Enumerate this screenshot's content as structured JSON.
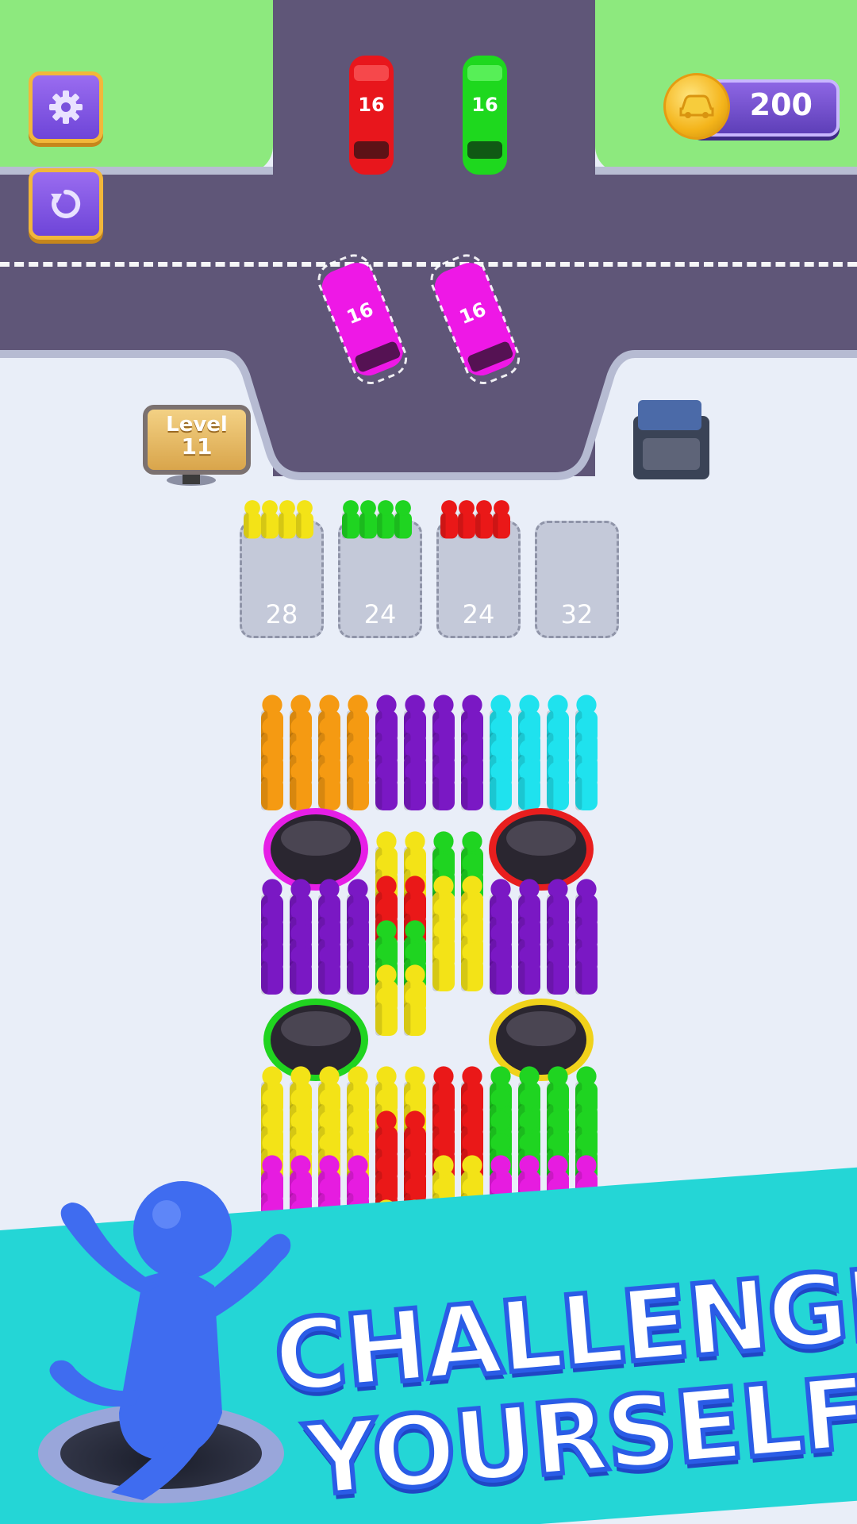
{
  "hud": {
    "coins": "200",
    "settings_icon": "gear-icon",
    "restart_icon": "restart-icon",
    "coin_icon": "coin-car-icon"
  },
  "buses_parked": [
    {
      "color": "#e8161c",
      "capacity": "16"
    },
    {
      "color": "#1ed81e",
      "capacity": "16"
    },
    {
      "color": "#ee18e6",
      "capacity": "16"
    },
    {
      "color": "#ee18e6",
      "capacity": "16"
    }
  ],
  "level": {
    "label": "Level",
    "number": "11"
  },
  "slots": [
    {
      "count": "28",
      "color": "#f3e317"
    },
    {
      "count": "24",
      "color": "#1fd421"
    },
    {
      "count": "24",
      "color": "#ea1818"
    },
    {
      "count": "32",
      "color": null
    }
  ],
  "holes": [
    {
      "color": "#e61ee6"
    },
    {
      "color": "#e81e1e"
    },
    {
      "color": "#20d420"
    },
    {
      "color": "#f0d21a"
    }
  ],
  "colors": {
    "orange": "#f59a12",
    "purple": "#7a18c4",
    "cyan": "#1fe2ee",
    "yellow": "#f3e317",
    "green": "#1fd421",
    "red": "#ea1818",
    "magenta": "#e61ce0"
  },
  "banner": {
    "line1": "CHALLENGE",
    "line2": "YOURSELF!"
  }
}
